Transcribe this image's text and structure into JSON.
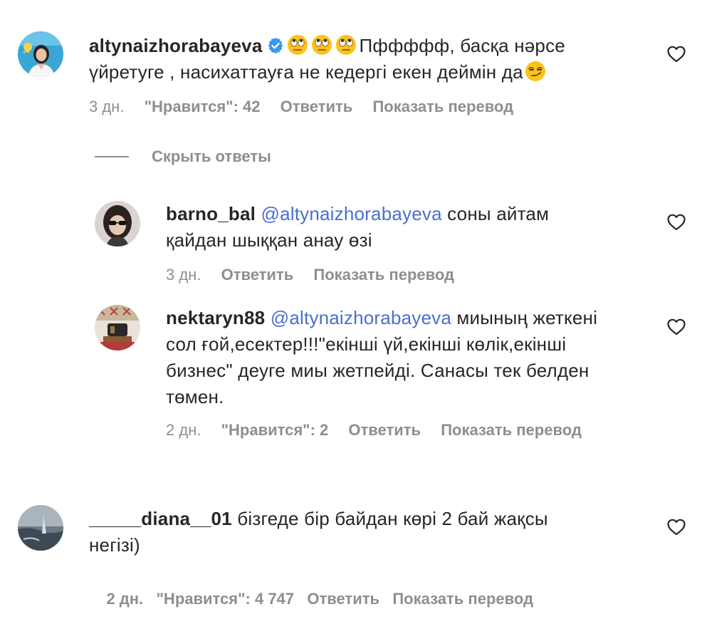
{
  "comments": [
    {
      "username": "altynaizhorabayeva",
      "verified": true,
      "emojis": [
        "face-with-rolling-eyes",
        "face-with-rolling-eyes",
        "face-with-rolling-eyes"
      ],
      "text_line1": "Пффффф, басқа нәрсе",
      "text_line2": "үйретуге , насихаттауға не кедергі екен деймін да",
      "trailing_emoji": "smirking-face",
      "time": "3 дн.",
      "likes": "\"Нравится\": 42",
      "reply_label": "Ответить",
      "translate_label": "Показать перевод"
    }
  ],
  "hide_replies_label": "Скрыть ответы",
  "replies": [
    {
      "username": "barno_bal",
      "mention": "@altynaizhorabayeva",
      "text_line1": "соны айтам",
      "text_line2": "қайдан шыққан анау өзі",
      "time": "3 дн.",
      "reply_label": "Ответить",
      "translate_label": "Показать перевод"
    },
    {
      "username": "nektaryn88",
      "mention": "@altynaizhorabayeva",
      "text_line1": "миының жеткені",
      "text_line2": "сол ғой,есектер!!!\"екінші үй,екінші көлік,екінші",
      "text_line3": "бизнес\" деуге миы жетпейді. Санасы тек белден",
      "text_line4": "төмен.",
      "time": "2 дн.",
      "likes": "\"Нравится\": 2",
      "reply_label": "Ответить",
      "translate_label": "Показать перевод"
    }
  ],
  "bottom_comment": {
    "username": "_____diana__01",
    "text_line1": "бізгеде бір байдан көрі 2 бай жақсы",
    "text_line2": "негізі)",
    "meta_partial": "2 дн.   \"Нравится\": 4 747   Ответить   Показать перевод"
  },
  "colors": {
    "text": "#262626",
    "secondary": "#8e8e8e",
    "mention": "#4a6fd1",
    "verified": "#3897f0"
  }
}
